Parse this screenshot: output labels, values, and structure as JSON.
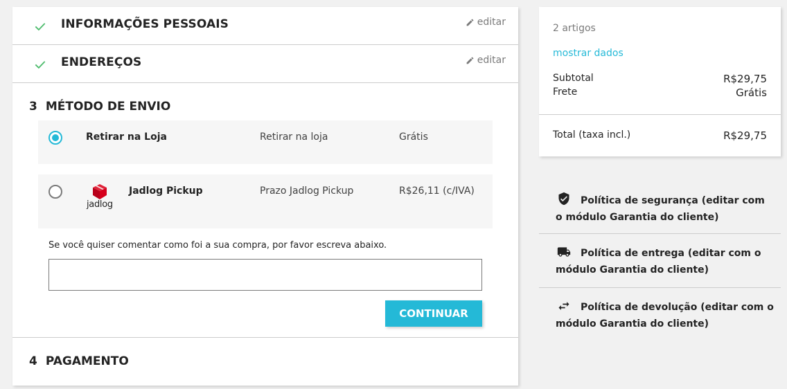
{
  "steps": {
    "personal": {
      "title": "INFORMAÇÕES PESSOAIS",
      "edit_label": "editar"
    },
    "addresses": {
      "title": "ENDEREÇOS",
      "edit_label": "editar"
    },
    "shipping": {
      "number": "3",
      "title": "MÉTODO DE ENVIO"
    },
    "payment": {
      "number": "4",
      "title": "PAGAMENTO"
    }
  },
  "carriers": [
    {
      "name": "Retirar na Loja",
      "delay": "Retirar na loja",
      "price": "Grátis",
      "selected": true
    },
    {
      "name": "Jadlog Pickup",
      "delay": "Prazo Jadlog Pickup",
      "price": "R$26,11 (c/IVA)",
      "selected": false,
      "logo_text": "jadlog"
    }
  ],
  "comment": {
    "label": "Se você quiser comentar como foi a sua compra, por favor escreva abaixo.",
    "value": ""
  },
  "continue_label": "CONTINUAR",
  "cart_summary": {
    "items_count": "2 artigos",
    "show_details": "mostrar dados",
    "subtotal_label": "Subtotal",
    "subtotal_value": "R$29,75",
    "shipping_label": "Frete",
    "shipping_value": "Grátis",
    "total_label": "Total (taxa incl.)",
    "total_value": "R$29,75"
  },
  "reassurance": [
    {
      "icon": "shield-check-icon",
      "text": "Política de segurança (editar com o módulo Garantia do cliente)"
    },
    {
      "icon": "truck-icon",
      "text": "Política de entrega (editar com o módulo Garantia do cliente)"
    },
    {
      "icon": "swap-arrows-icon",
      "text": "Política de devolução (editar com o módulo Garantia do cliente)"
    }
  ],
  "colors": {
    "accent": "#24b9d7",
    "check": "#4cbb6c",
    "jadlog_red": "#d6001c"
  }
}
